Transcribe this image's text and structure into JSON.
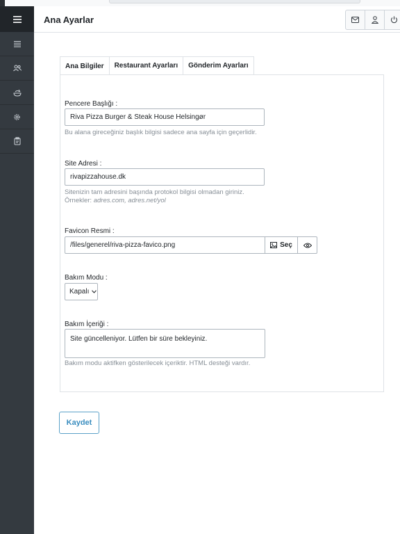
{
  "header": {
    "title": "Ana Ayarlar"
  },
  "tabs": [
    {
      "label": "Ana Bilgiler",
      "active": true
    },
    {
      "label": "Restaurant Ayarları",
      "active": false
    },
    {
      "label": "Gönderim Ayarları",
      "active": false
    }
  ],
  "form": {
    "title": {
      "label": "Pencere Başlığı :",
      "value": "Riva Pizza Burger & Steak House Helsingør",
      "help": "Bu alana gireceğiniz başlık bilgisi sadece ana sayfa için geçerlidir."
    },
    "site_address": {
      "label": "Site Adresi :",
      "value": "rivapizzahouse.dk",
      "help_line1": "Sitenizin tam adresini başında protokol bilgisi olmadan giriniz.",
      "help_line2_prefix": "Örnekler:",
      "help_line2_examples": "adres.com, adres.net/yol"
    },
    "favicon": {
      "label": "Favicon Resmi :",
      "value": "/files/generel/riva-pizza-favico.png",
      "select_button": "Seç"
    },
    "maintenance_mode": {
      "label": "Bakım Modu :",
      "selected": "Kapalı"
    },
    "maintenance_content": {
      "label": "Bakım İçeriği :",
      "value": "Site güncelleniyor. Lütfen bir süre bekleyiniz.",
      "help": "Bakım modu aktifken gösterilecek içeriktir. HTML desteği vardır."
    }
  },
  "save_button": "Kaydet",
  "icons": {
    "sidebar": [
      "hamburger-icon",
      "list-icon",
      "users-icon",
      "food-icon",
      "gear-icon",
      "clipboard-icon"
    ],
    "header": [
      "mail-icon",
      "user-icon",
      "power-icon"
    ]
  }
}
